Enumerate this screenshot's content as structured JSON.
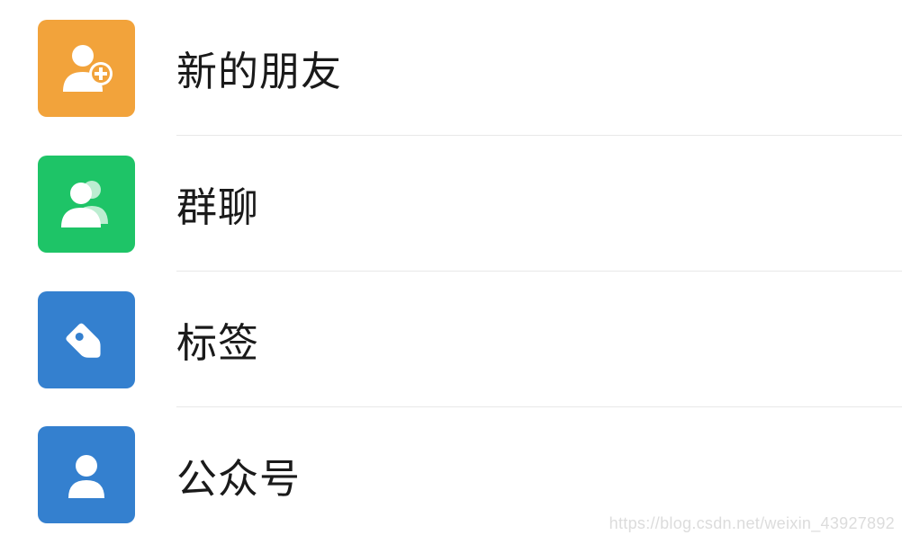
{
  "contacts_menu": {
    "items": [
      {
        "label": "新的朋友",
        "icon": "add-friend-icon",
        "color": "#f2a33b"
      },
      {
        "label": "群聊",
        "icon": "group-chat-icon",
        "color": "#1ec467"
      },
      {
        "label": "标签",
        "icon": "tag-icon",
        "color": "#3480cf"
      },
      {
        "label": "公众号",
        "icon": "official-account-icon",
        "color": "#3480cf"
      }
    ]
  },
  "watermark": "https://blog.csdn.net/weixin_43927892"
}
